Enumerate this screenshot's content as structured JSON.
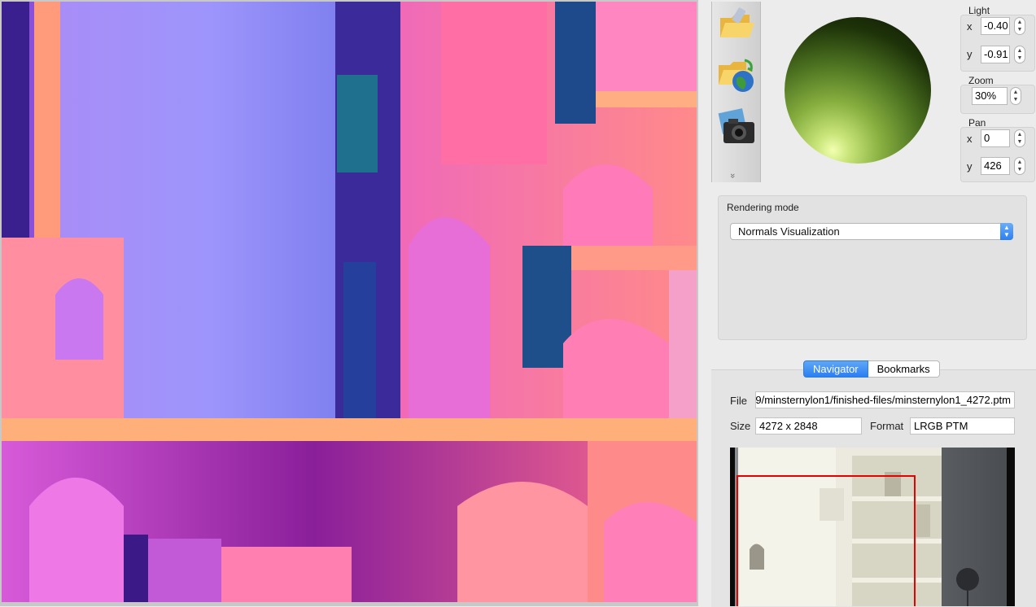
{
  "toolbar": {
    "items": [
      {
        "name": "open-file-button"
      },
      {
        "name": "open-remote-button"
      },
      {
        "name": "snapshot-button"
      }
    ],
    "more_label": "»"
  },
  "light": {
    "title": "Light",
    "x_label": "x",
    "x_value": "-0.40",
    "y_label": "y",
    "y_value": "-0.91"
  },
  "zoom": {
    "title": "Zoom",
    "value": "30%"
  },
  "pan": {
    "title": "Pan",
    "x_label": "x",
    "x_value": "0",
    "y_label": "y",
    "y_value": "426"
  },
  "rendering": {
    "title": "Rendering mode",
    "selected": "Normals Visualization"
  },
  "tabs": {
    "navigator": "Navigator",
    "bookmarks": "Bookmarks"
  },
  "info": {
    "file_label": "File",
    "file_value": "9/minsternylon1/finished-files/minsternylon1_4272.ptm",
    "size_label": "Size",
    "size_value": "4272 x 2848",
    "format_label": "Format",
    "format_value": "LRGB PTM"
  },
  "colors": {
    "accent": "#2b7ff1",
    "viewport_rect": "#e60000"
  }
}
